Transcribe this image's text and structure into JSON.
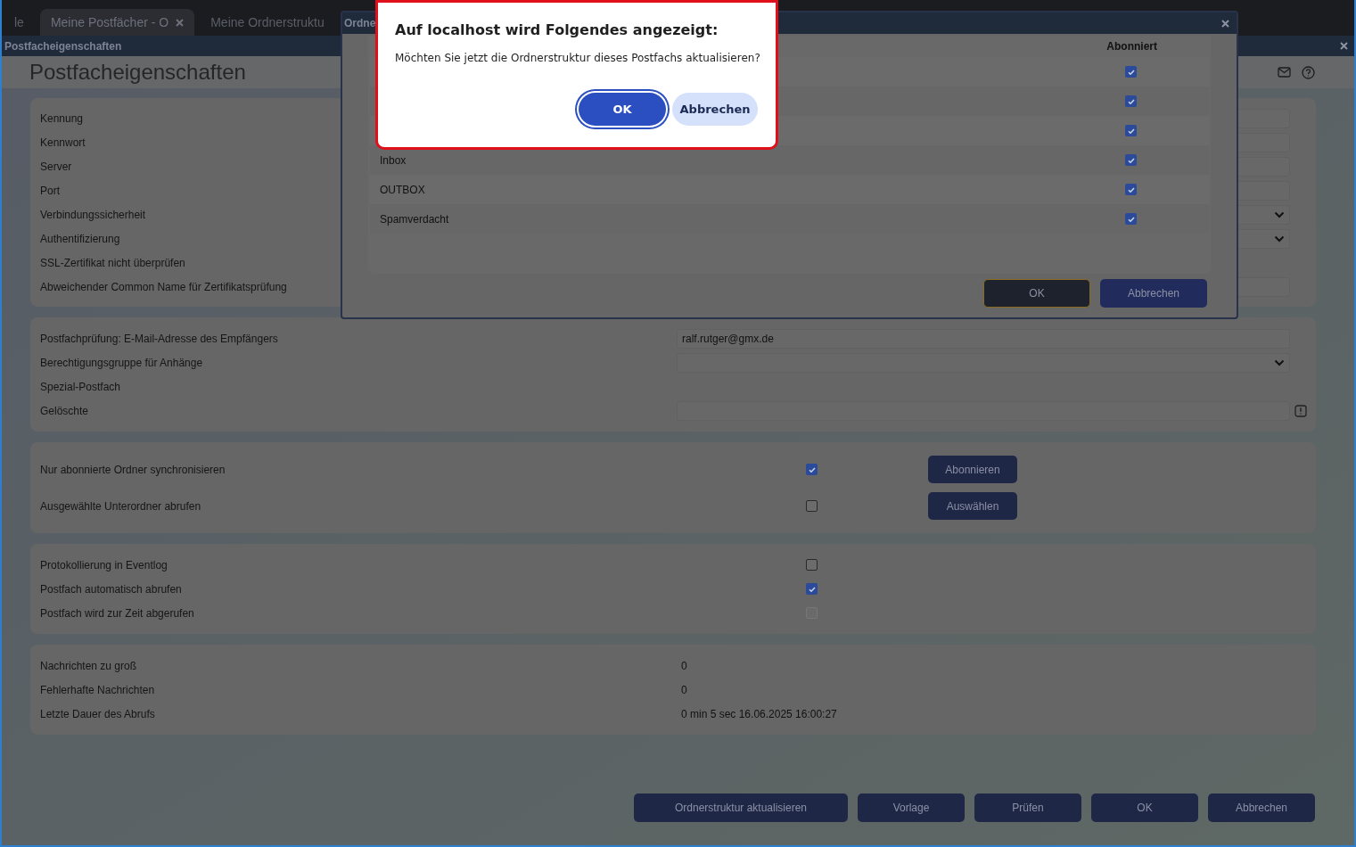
{
  "browser_tabs": [
    {
      "label": "le",
      "selected": false
    },
    {
      "label": "Meine Postfächer - O",
      "selected": true
    },
    {
      "label": "Meine Ordnerstruktu",
      "selected": false
    }
  ],
  "window": {
    "title": "Postfacheigenschaften",
    "heading": "Postfacheigenschaften"
  },
  "sections": [
    {
      "rows": [
        {
          "label": "Kennung",
          "kind": "text"
        },
        {
          "label": "Kennwort",
          "kind": "text"
        },
        {
          "label": "Server",
          "kind": "text"
        },
        {
          "label": "Port",
          "kind": "text"
        },
        {
          "label": "Verbindungssicherheit",
          "kind": "select"
        },
        {
          "label": "Authentifizierung",
          "kind": "select"
        },
        {
          "label": "SSL-Zertifikat nicht überprüfen",
          "kind": "none"
        },
        {
          "label": "Abweichender Common Name für Zertifikatsprüfung",
          "kind": "text"
        }
      ]
    },
    {
      "rows": [
        {
          "label": "Postfachprüfung: E-Mail-Adresse des Empfängers",
          "kind": "text",
          "value": "ralf.rutger@gmx.de"
        },
        {
          "label": "Berechtigungsgruppe für Anhänge",
          "kind": "select"
        },
        {
          "label": "Spezial-Postfach",
          "kind": "none"
        },
        {
          "label": "Gelöschte",
          "kind": "text_icon"
        }
      ]
    },
    {
      "rows": [
        {
          "label": "Nur abonnierte Ordner synchronisieren",
          "kind": "checkbox_button",
          "checked": true,
          "button": "Abonnieren"
        },
        {
          "label": "Ausgewählte Unterordner abrufen",
          "kind": "checkbox_button",
          "checked": false,
          "button": "Auswählen"
        }
      ]
    },
    {
      "rows": [
        {
          "label": "Protokollierung in Eventlog",
          "kind": "checkbox",
          "checked": false,
          "disabled": false
        },
        {
          "label": "Postfach automatisch abrufen",
          "kind": "checkbox",
          "checked": true,
          "disabled": false
        },
        {
          "label": "Postfach wird zur Zeit abgerufen",
          "kind": "checkbox",
          "checked": false,
          "disabled": true
        }
      ]
    },
    {
      "rows": [
        {
          "label": "Nachrichten zu groß",
          "kind": "value",
          "value": "0"
        },
        {
          "label": "Fehlerhafte Nachrichten",
          "kind": "value",
          "value": "0"
        },
        {
          "label": "Letzte Dauer des Abrufs",
          "kind": "value",
          "value": "0 min 5 sec 16.06.2025 16:00:27"
        }
      ]
    }
  ],
  "footer_buttons": [
    "Ordnerstruktur aktualisieren",
    "Vorlage",
    "Prüfen",
    "OK",
    "Abbrechen"
  ],
  "folder_dialog": {
    "title": "Ordne",
    "column": "Abonniert",
    "rows": [
      {
        "subscribed": true
      },
      {
        "subscribed": true
      },
      {
        "subscribed": true
      },
      {
        "name": "Inbox",
        "subscribed": true
      },
      {
        "name": "OUTBOX",
        "subscribed": true
      },
      {
        "name": "Spamverdacht",
        "subscribed": true
      }
    ],
    "buttons": [
      {
        "label": "OK",
        "focused": true
      },
      {
        "label": "Abbrechen",
        "focused": false
      }
    ]
  },
  "alert": {
    "title": "Auf localhost wird Folgendes angezeigt:",
    "message": "Möchten Sie jetzt die Ordnerstruktur dieses Postfachs aktualisieren?",
    "buttons": [
      {
        "label": "OK",
        "focused": true
      },
      {
        "label": "Abbrechen",
        "focused": false
      }
    ]
  }
}
